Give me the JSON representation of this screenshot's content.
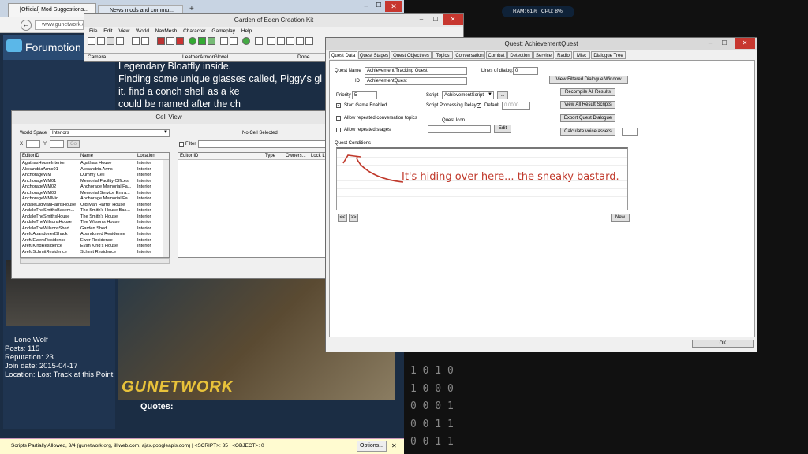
{
  "browser": {
    "tabs": [
      "[Official] Mod Suggestions...",
      "News mods and commu..."
    ],
    "url": "www.gunetwork.c",
    "forum_logo": "Forumotion",
    "overlay_text": "Legendary Bloatfly inside.\nFinding some unique glasses called, Piggy's gl\nit. find a conch shell as a ke\ncould be named after the ch",
    "user": {
      "name": "Lone Wolf",
      "posts": "Posts: 115",
      "reputation": "Reputation: 23",
      "join": "Join date: 2015-04-17",
      "location": "Location: Lost Track at this Point"
    },
    "banner": "GUNETWORK",
    "quotes": "Quotes:",
    "status": "Scripts Partially Allowed, 3/4 (gunetwork.org, illiweb.com, ajax.googleapis.com) | <SCRIPT>: 35 | <OBJECT>: 0",
    "options": "Options..."
  },
  "monitor": {
    "ram": "RAM: 61%",
    "cpu": "CPU: 8%"
  },
  "binary_rows": [
    "1 0 1 0",
    "1 0 0 0",
    "0 0 0 1",
    "0 0 1 1",
    "0 0 1 1"
  ],
  "geck": {
    "title": "Garden of Eden Creation Kit",
    "menu": [
      "File",
      "Edit",
      "View",
      "World",
      "NavMesh",
      "Character",
      "Gameplay",
      "Help"
    ],
    "status": [
      "Camera",
      "LeatherArmorGloveL",
      "Done."
    ]
  },
  "cell_view": {
    "title": "Cell View",
    "world_space_label": "World Space",
    "world_space_value": "Interiors",
    "x_label": "X",
    "y_label": "Y",
    "go_label": "Go",
    "no_cell": "No Cell Selected",
    "filter_label": "Filter",
    "left_columns": [
      "EditorID",
      "Name",
      "Location"
    ],
    "right_columns": [
      "Editor ID",
      "Type",
      "Owners...",
      "Lock L"
    ],
    "rows": [
      [
        "AgathasHouseInterior",
        "Agatha's House",
        "Interior"
      ],
      [
        "AlexandriaArms01",
        "Alexandria Arms",
        "Interior"
      ],
      [
        "AnchorageWM",
        "Dummy Cell",
        "Interior"
      ],
      [
        "AnchorageWM01",
        "Memorial Facility Offices",
        "Interior"
      ],
      [
        "AnchorageWM02",
        "Anchorage Memorial Fa...",
        "Interior"
      ],
      [
        "AnchorageWM03",
        "Memorial Service Entra...",
        "Interior"
      ],
      [
        "AnchorageWMMid",
        "Anchorage Memorial Fa...",
        "Interior"
      ],
      [
        "AndaleOldManHarrisHouse",
        "Old Man Harris' House",
        "Interior"
      ],
      [
        "AndaleTheSmithsBasem...",
        "The Smith's House Bas...",
        "Interior"
      ],
      [
        "AndaleTheSmithsHouse",
        "The Smith's House",
        "Interior"
      ],
      [
        "AndaleTheWilsonsHouse",
        "The Wilson's House",
        "Interior"
      ],
      [
        "AndaleTheWilsonsShed",
        "Garden Shed",
        "Interior"
      ],
      [
        "ArefuAbandonedShack",
        "Abandoned Residence",
        "Interior"
      ],
      [
        "ArefuEwersResidence",
        "Ewer Residence",
        "Interior"
      ],
      [
        "ArefuKingResidence",
        "Evan King's House",
        "Interior"
      ],
      [
        "ArefuSchmitResidence",
        "Schmit Residence",
        "Interior"
      ]
    ]
  },
  "quest": {
    "title": "Quest: AchievementQuest",
    "tabs": [
      "Quest Data",
      "Quest Stages",
      "Quest Objectives",
      "Topics",
      "Conversation",
      "Combat",
      "Detection",
      "Service",
      "Radio",
      "Misc",
      "Dialogue Tree"
    ],
    "quest_name_label": "Quest Name",
    "quest_name": "Achievement Tracking Quest",
    "id_label": "ID",
    "id": "AchievementQuest",
    "lines_label": "Lines of dialog:",
    "lines": "0",
    "priority_label": "Priority",
    "priority": "5",
    "script_label": "Script",
    "script": "AchievementScript",
    "script_btn": "...",
    "delay_label": "Script Processing Delay",
    "default_label": "Default",
    "delay": "0.0000",
    "start_enabled": "Start Game Enabled",
    "allow_conv": "Allow repeated conversation topics",
    "allow_stages": "Allow repeated stages",
    "icon_label": "Quest Icon",
    "edit": "Edit",
    "right_buttons": [
      "View Filtered Dialogue Window",
      "Recompile All Results",
      "View All Result Scripts",
      "Export Quest Dialogue",
      "Calculate voice assets"
    ],
    "conditions_label": "Quest Conditions",
    "annotation": "It's hiding over here... the sneaky bastard.",
    "prev": "<<",
    "next": ">>",
    "new": "New",
    "ok": "OK"
  },
  "colors": {
    "annotation": "#c0392b",
    "forum_bg": "#1d3553",
    "close": "#c7372f"
  }
}
